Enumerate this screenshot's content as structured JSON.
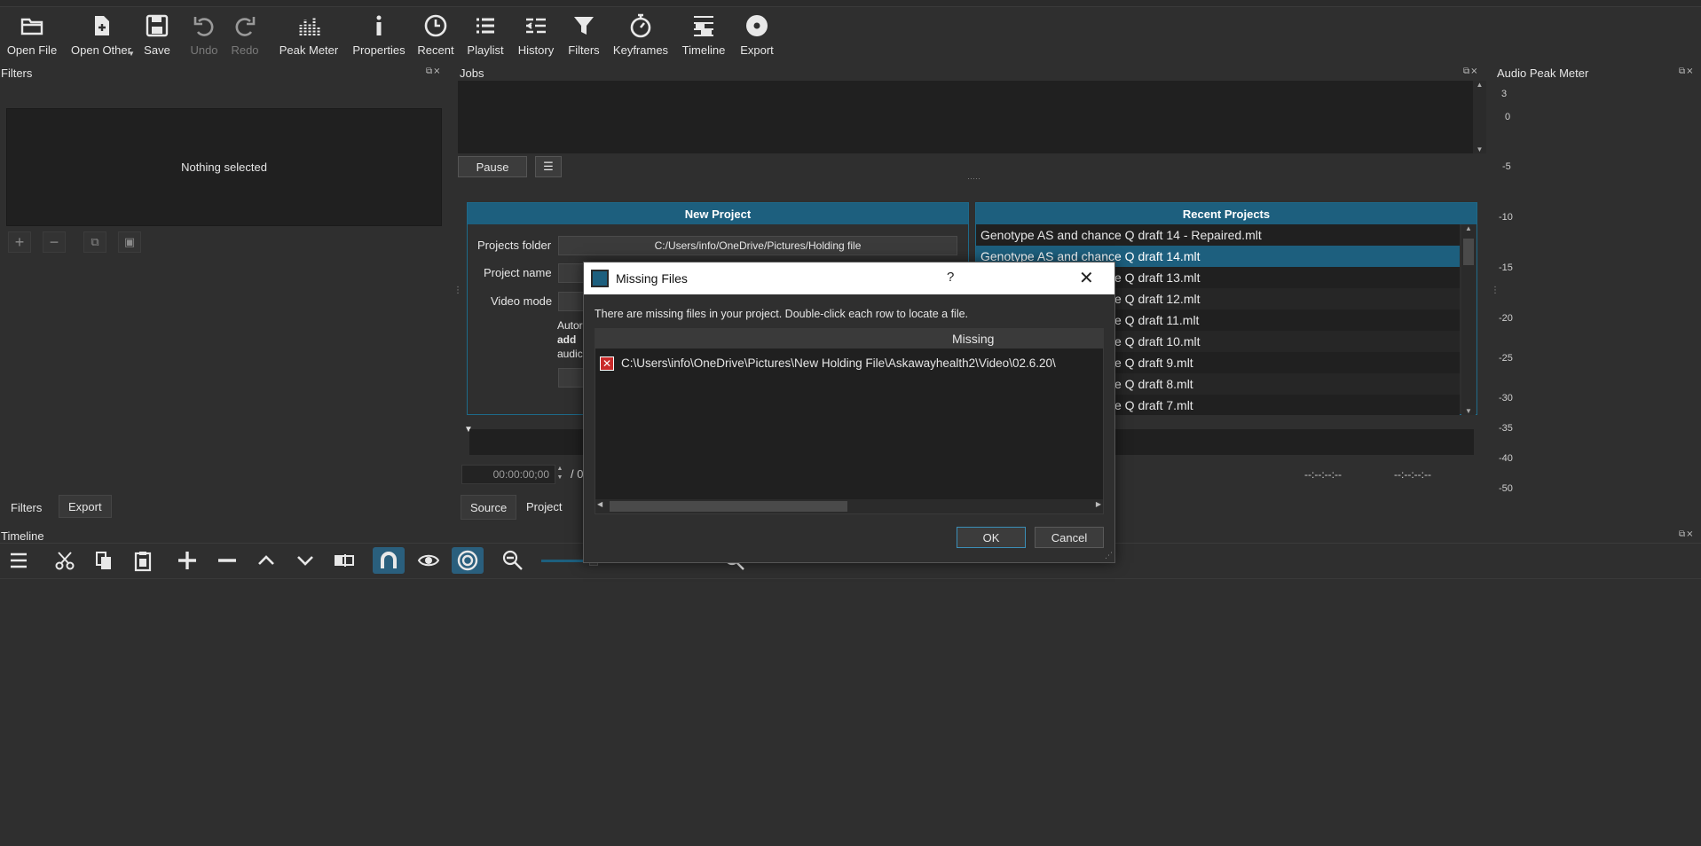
{
  "toolbar": {
    "items": [
      {
        "label": "Open File",
        "icon": "folder-icon"
      },
      {
        "label": "Open Other",
        "icon": "add-file-icon"
      },
      {
        "label": "Save",
        "icon": "save-icon"
      },
      {
        "label": "Undo",
        "icon": "undo-icon"
      },
      {
        "label": "Redo",
        "icon": "redo-icon"
      },
      {
        "label": "Peak Meter",
        "icon": "peak-meter-icon"
      },
      {
        "label": "Properties",
        "icon": "info-icon"
      },
      {
        "label": "Recent",
        "icon": "clock-icon"
      },
      {
        "label": "Playlist",
        "icon": "list-icon"
      },
      {
        "label": "History",
        "icon": "history-icon"
      },
      {
        "label": "Filters",
        "icon": "funnel-icon"
      },
      {
        "label": "Keyframes",
        "icon": "stopwatch-icon"
      },
      {
        "label": "Timeline",
        "icon": "timeline-icon"
      },
      {
        "label": "Export",
        "icon": "disc-icon"
      }
    ]
  },
  "filters_panel": {
    "title": "Filters",
    "empty_text": "Nothing selected",
    "tabs": [
      "Filters",
      "Export"
    ]
  },
  "jobs_panel": {
    "title": "Jobs",
    "pause_label": "Pause"
  },
  "audio_meter": {
    "title": "Audio Peak Meter",
    "scale": [
      "3",
      "0",
      "-5",
      "-10",
      "-15",
      "-20",
      "-25",
      "-30",
      "-35",
      "-40",
      "-50"
    ]
  },
  "new_project": {
    "title": "New Project",
    "projects_folder_label": "Projects folder",
    "projects_folder_value": "C:/Users/info/OneDrive/Pictures/Holding file",
    "project_name_label": "Project name",
    "video_mode_label": "Video mode",
    "auto_text_1": "Autor",
    "auto_text_2": "add",
    "auto_text_3": "audic"
  },
  "recent_projects": {
    "title": "Recent Projects",
    "items": [
      "Genotype AS and chance Q draft 14 - Repaired.mlt",
      "Genotype AS and chance Q draft 14.mlt",
      "Genotype AS and chance Q draft 13.mlt",
      "Genotype AS and chance Q draft 12.mlt",
      "Genotype AS and chance Q draft 11.mlt",
      "Genotype AS and chance Q draft 10.mlt",
      "Genotype AS and chance Q draft 9.mlt",
      "Genotype AS and chance Q draft 8.mlt",
      "Genotype AS and chance Q draft 7.mlt"
    ]
  },
  "player": {
    "timecode": "00:00:00;00",
    "slash": "/ 0",
    "in_point": "--:--:--:--",
    "out_point": "--:--:--:--",
    "tabs": [
      "Source",
      "Project"
    ]
  },
  "timeline": {
    "title": "Timeline"
  },
  "dialog": {
    "title": "Missing Files",
    "help": "?",
    "message": "There are missing files in your project. Double-click each row to locate a file.",
    "column": "Missing",
    "rows": [
      "C:\\Users\\info\\OneDrive\\Pictures\\New Holding File\\Askawayhealth2\\Video\\02.6.20\\"
    ],
    "ok_label": "OK",
    "cancel_label": "Cancel"
  }
}
